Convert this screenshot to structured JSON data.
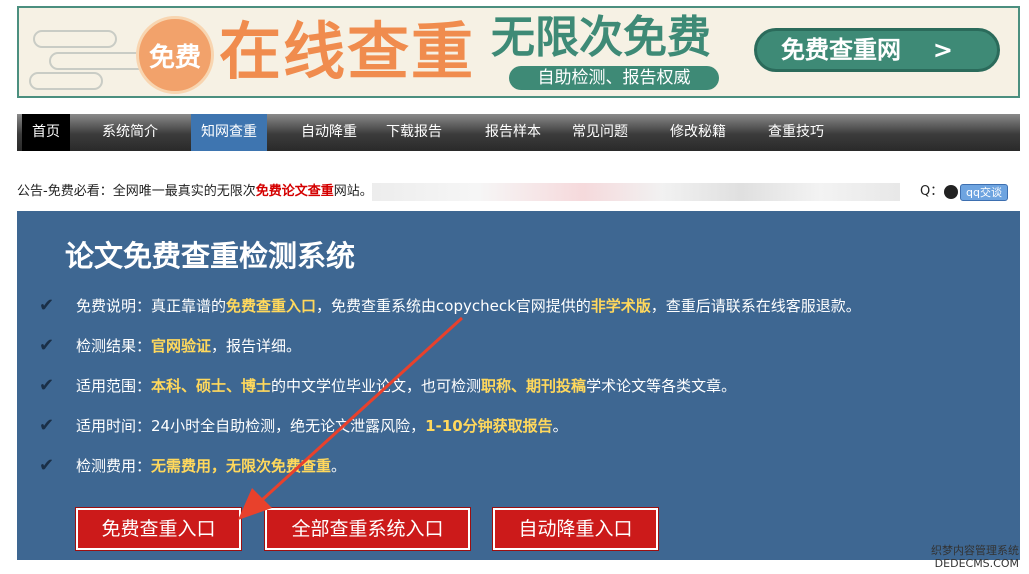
{
  "banner": {
    "badge": "免费",
    "headline": "在线查重",
    "slogan": "无限次免费",
    "subline": "自助检测、报告权威",
    "cta": "免费查重网"
  },
  "nav": {
    "items": [
      "首页",
      "系统简介",
      "知网查重",
      "自动降重",
      "下载报告",
      "报告样本",
      "常见问题",
      "修改秘籍",
      "查重技巧"
    ],
    "active": "知网查重"
  },
  "notice": {
    "prefix": "公告-免费必看：全网唯一最真实的无限次",
    "highlight": "免费论文查重",
    "suffix": "网站。",
    "qq_label": "Q：",
    "qq_button": "qq交谈"
  },
  "main": {
    "title": "论文免费查重检测系统",
    "lines": [
      {
        "p1": "免费说明：真正靠谱的",
        "h1": "免费查重入口",
        "p2": "，免费查重系统由copycheck官网提供的",
        "h2": "非学术版",
        "p3": "，查重后请联系在线客服退款。"
      },
      {
        "p1": "检测结果：",
        "h1": "官网验证",
        "p2": "，报告详细。",
        "h2": "",
        "p3": ""
      },
      {
        "p1": "适用范围：",
        "h1": "本科、硕士、博士",
        "p2": "的中文学位毕业论文，也可检测",
        "h2": "职称、期刊投稿",
        "p3": "学术论文等各类文章。"
      },
      {
        "p1": "适用时间：24小时全自助检测，绝无论文泄露风险，",
        "h1": "1-10分钟获取报告",
        "p2": "。",
        "h2": "",
        "p3": ""
      },
      {
        "p1": "检测费用：",
        "h1": "无需费用，无限次免费查重",
        "p2": "。",
        "h2": "",
        "p3": ""
      }
    ],
    "buttons": [
      "免费查重入口",
      "全部查重系统入口",
      "自动降重入口"
    ]
  },
  "watermark": {
    "line1": "织梦内容管理系统",
    "line2": "DEDECMS.COM"
  },
  "colors": {
    "panel": "#3e6792",
    "highlight": "#ffd85c",
    "button": "#cc1a1a",
    "arrow": "#e8412c",
    "nav_active": "#3e75b0"
  }
}
